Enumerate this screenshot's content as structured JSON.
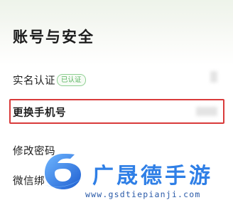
{
  "page": {
    "title": "账号与安全"
  },
  "rows": [
    {
      "label": "实名认证",
      "badge": "已认证"
    },
    {
      "label": "更换手机号"
    },
    {
      "label": "修改密码"
    },
    {
      "label": "微信绑"
    }
  ],
  "watermark": {
    "brand": "广晟德手游",
    "url": "www.gsdtiepianji.com"
  },
  "colors": {
    "highlight": "#d93b3b",
    "badge": "#58b45f",
    "watermark_brand": "#2f7fe6"
  }
}
